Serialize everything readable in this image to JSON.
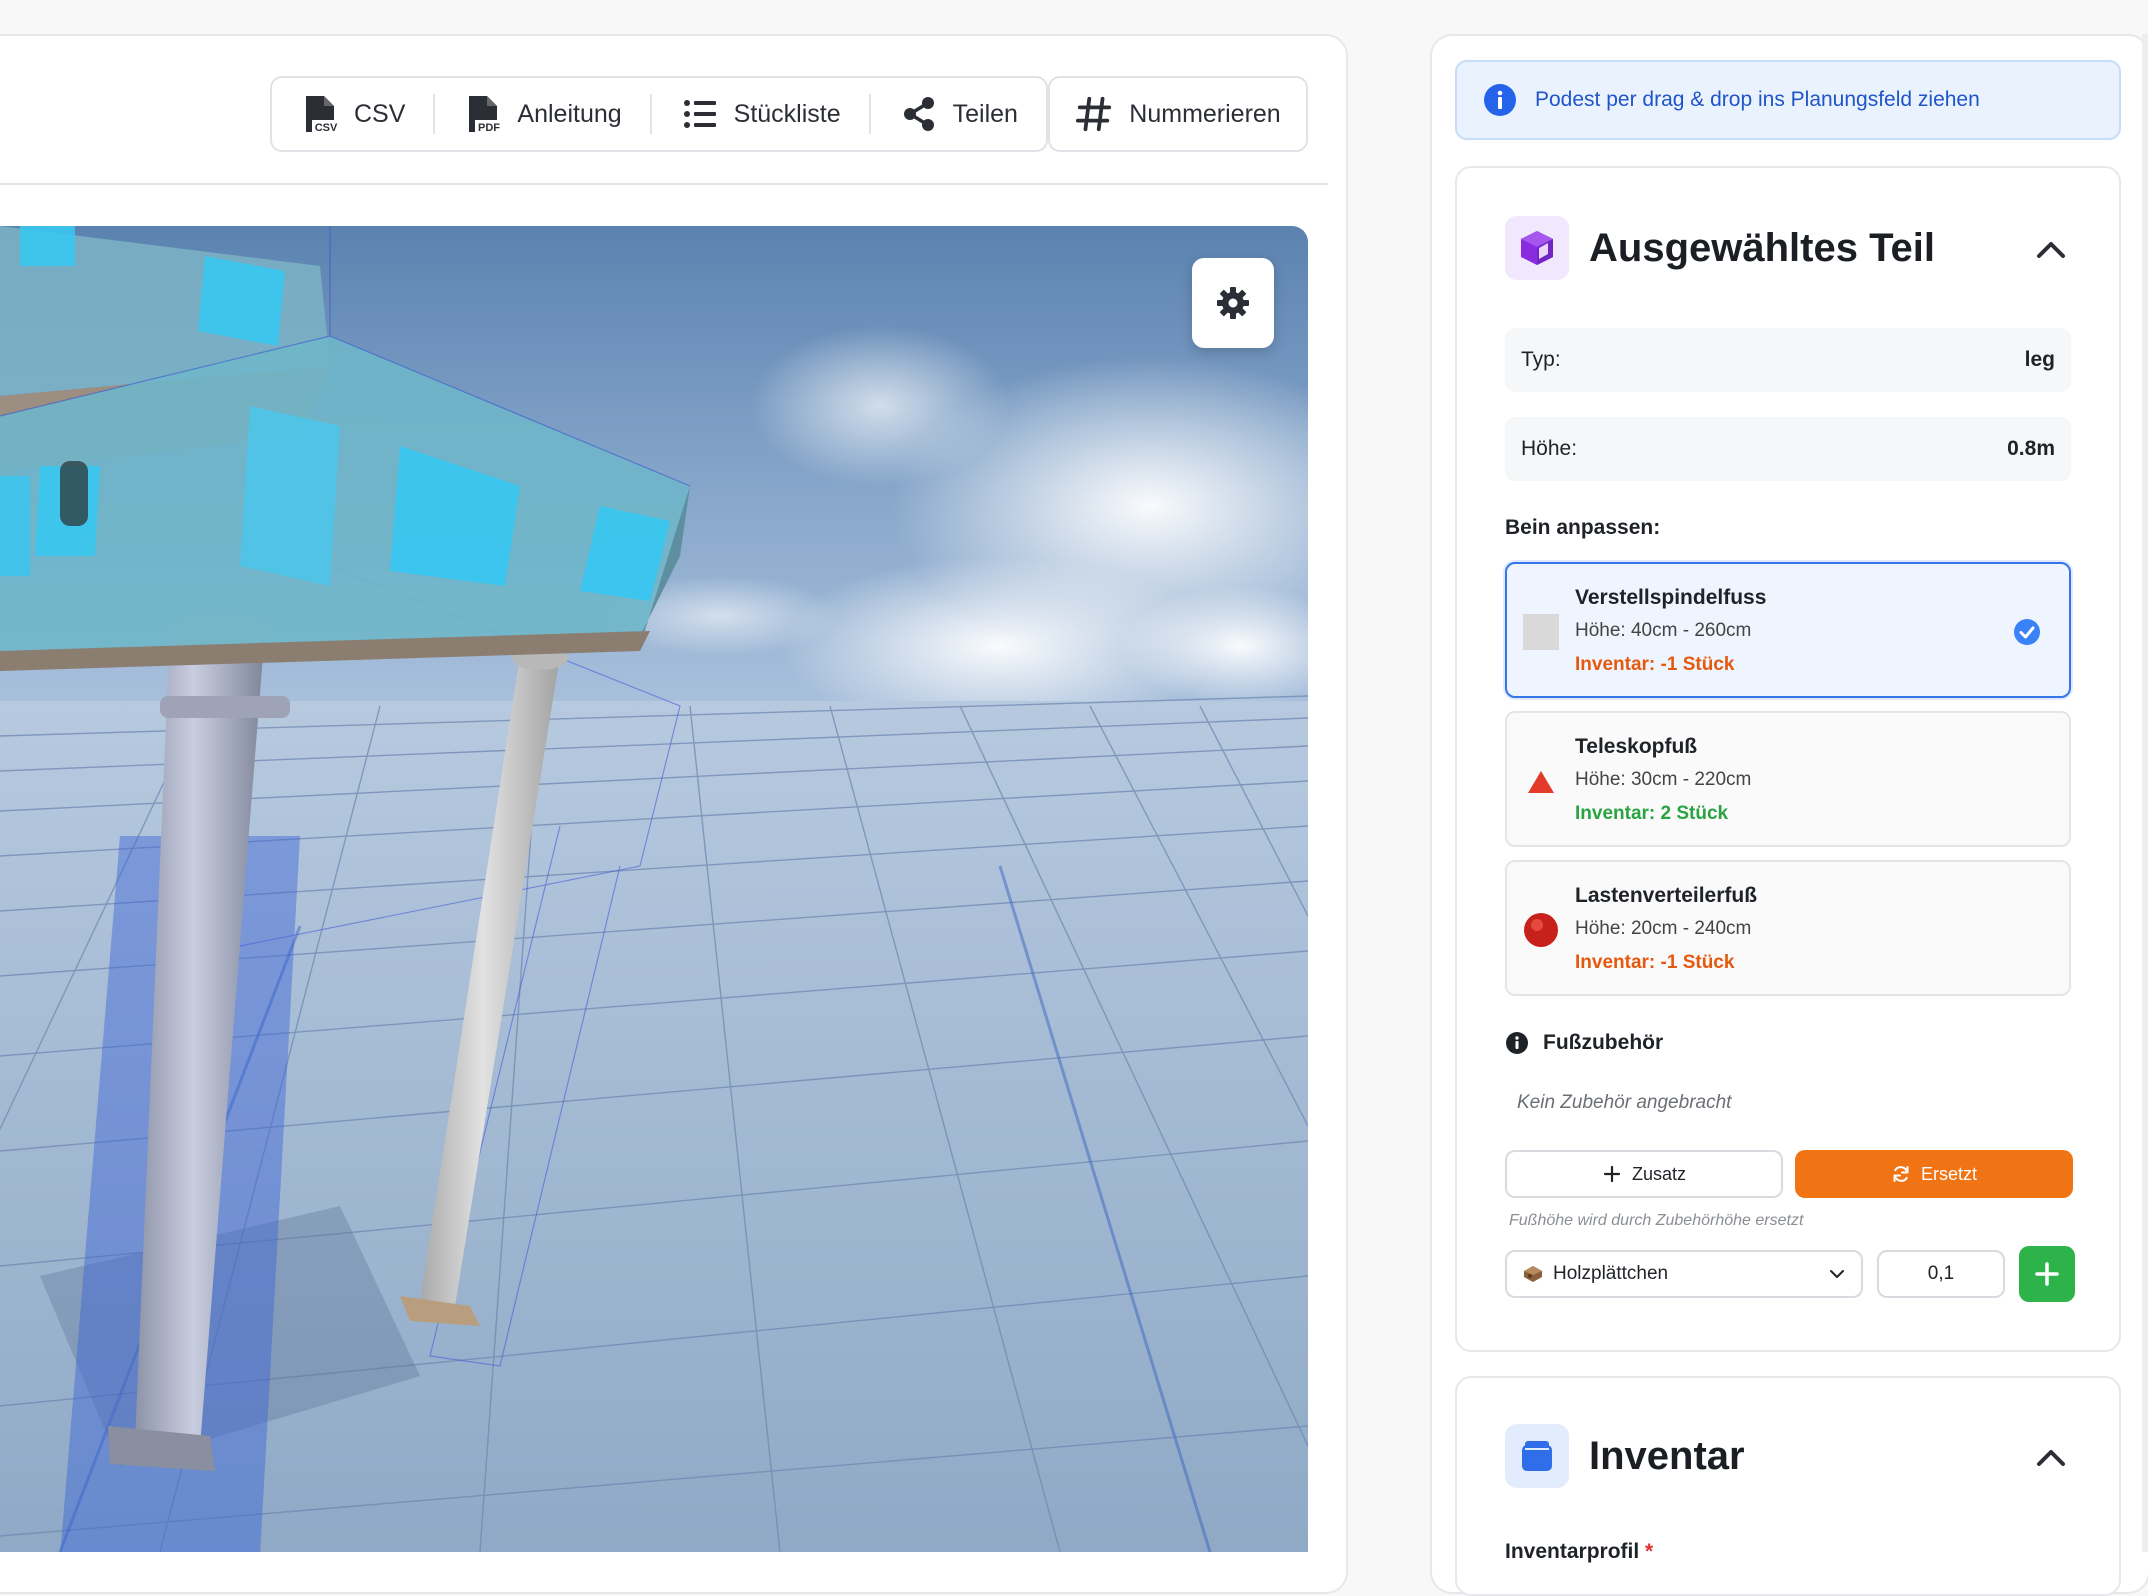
{
  "toolbar": {
    "csv_label": "CSV",
    "guide_label": "Anleitung",
    "parts_list_label": "Stückliste",
    "share_label": "Teilen",
    "number_label": "Nummerieren",
    "icons": [
      "csv-file-icon",
      "pdf-file-icon",
      "list-icon",
      "share-icon",
      "hash-icon"
    ]
  },
  "viewport": {
    "settings_icon": "gear-icon"
  },
  "hint": {
    "text": "Podest per drag & drop ins Planungsfeld ziehen",
    "icon": "info-icon"
  },
  "selected_part": {
    "title": "Ausgewähltes Teil",
    "type_label": "Typ:",
    "type_value": "leg",
    "height_label": "Höhe:",
    "height_value": "0.8m",
    "adjust_label": "Bein anpassen:",
    "options": [
      {
        "name": "Verstellspindelfuss",
        "height": "Höhe: 40cm - 260cm",
        "inventory": "Inventar: -1 Stück",
        "selected": true
      },
      {
        "name": "Teleskopfuß",
        "height": "Höhe: 30cm - 220cm",
        "inventory": "Inventar: 2 Stück",
        "selected": false
      },
      {
        "name": "Lastenverteilerfuß",
        "height": "Höhe: 20cm - 240cm",
        "inventory": "Inventar: -1 Stück",
        "selected": false
      }
    ],
    "accessory_label": "Fußzubehör",
    "accessory_empty": "Kein Zubehör angebracht",
    "add_label": "Zusatz",
    "replace_label": "Ersetzt",
    "replace_note": "Fußhöhe wird durch Zubehörhöhe ersetzt",
    "accessory_select": "Holzplättchen",
    "accessory_qty": "0,1"
  },
  "inventory": {
    "title": "Inventar",
    "profile_label": "Inventarprofil",
    "required_mark": "*"
  },
  "colors": {
    "accent_blue": "#3575e8",
    "orange": "#f07414",
    "green": "#2db34a",
    "purple": "#8a2be2"
  }
}
